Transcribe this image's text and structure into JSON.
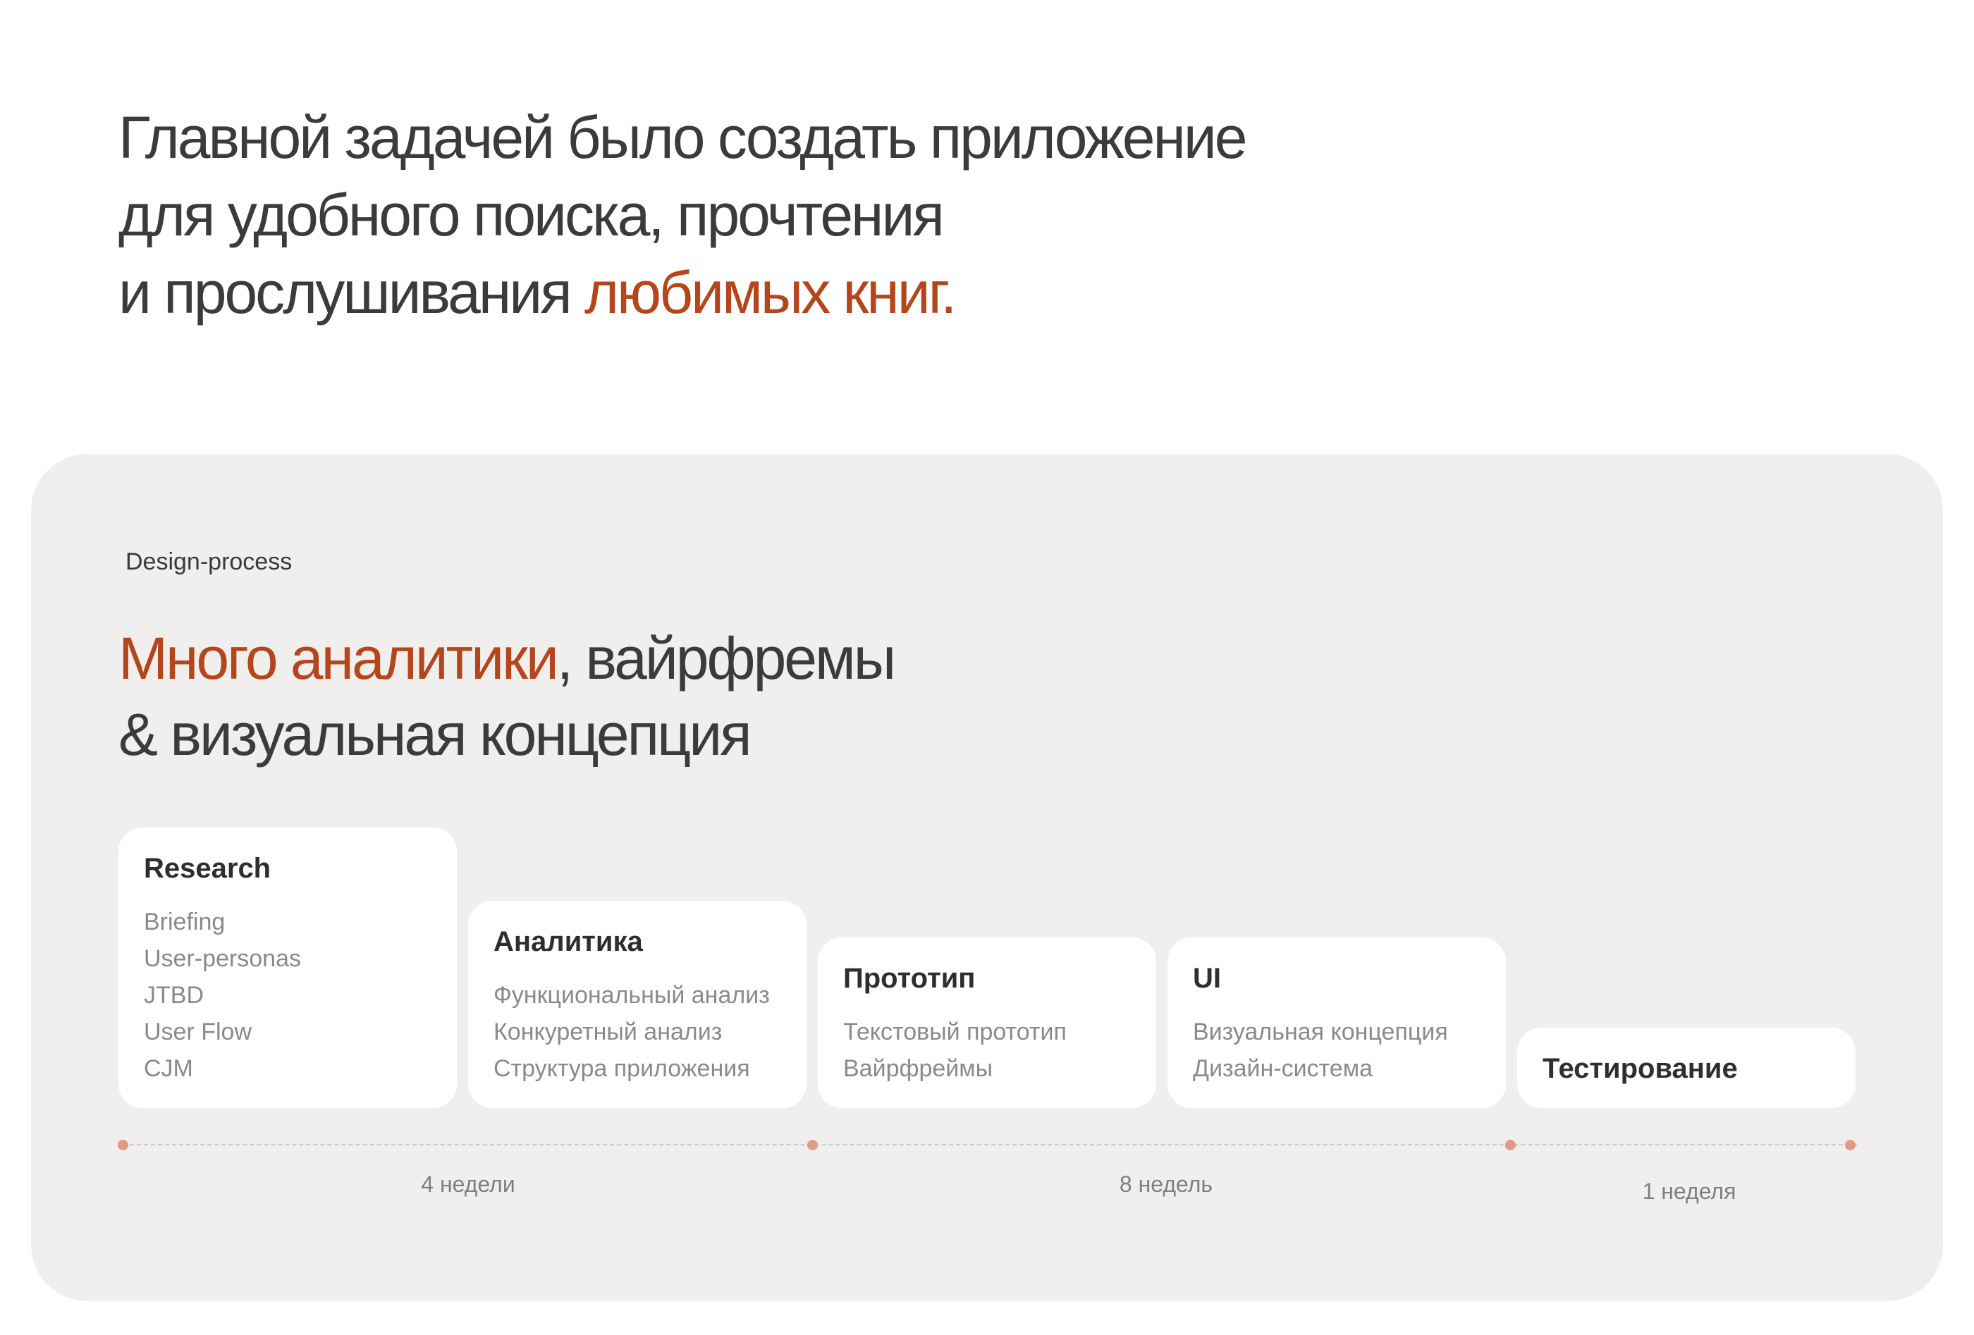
{
  "hero": {
    "line1": "Главной задачей было создать приложение",
    "line2": "для удобного поиска, прочтения",
    "line3_plain": "и прослушивания ",
    "line3_accent": "любимых книг."
  },
  "panel": {
    "eyebrow": "Design-process",
    "title_accent": "Много аналитики",
    "title_rest": ", вайрфремы",
    "title_line2": "& визуальная концепция"
  },
  "stages": [
    {
      "title": "Research",
      "items": [
        "Briefing",
        "User-personas",
        "JTBD",
        "User Flow",
        "CJM"
      ]
    },
    {
      "title": "Аналитика",
      "items": [
        "Функциональный анализ",
        "Конкуретный анализ",
        "Структура приложения"
      ]
    },
    {
      "title": "Прототип",
      "items": [
        "Текстовый прототип",
        "Вайрфреймы"
      ]
    },
    {
      "title": "UI",
      "items": [
        "Визуальная концепция",
        "Дизайн-система"
      ]
    },
    {
      "title": "Тестирование",
      "items": []
    }
  ],
  "durations": [
    "4 недели",
    "8 недель",
    "1 неделя"
  ],
  "colors": {
    "accent": "#b5451b",
    "panel_bg": "#f0efed",
    "timeline_dot": "#df9b86"
  }
}
